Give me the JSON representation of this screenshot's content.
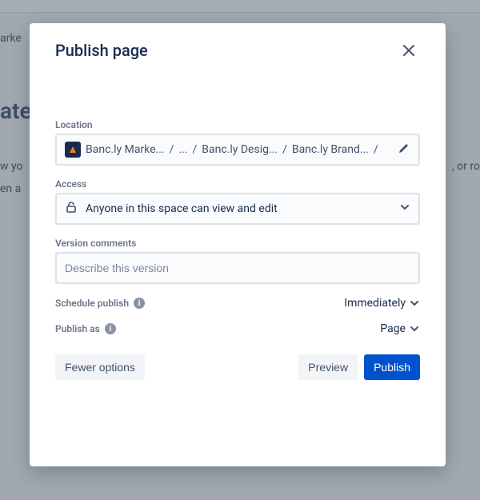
{
  "modal": {
    "title": "Publish page",
    "location": {
      "label": "Location",
      "segments": [
        "Banc.ly Marke...",
        "...",
        "Banc.ly Desig...",
        "Banc.ly Brand..."
      ],
      "sep": "/"
    },
    "access": {
      "label": "Access",
      "value": "Anyone in this space can view and edit"
    },
    "version": {
      "label": "Version comments",
      "placeholder": "Describe this version"
    },
    "schedule": {
      "label": "Schedule publish",
      "value": "Immediately"
    },
    "publishAs": {
      "label": "Publish as",
      "value": "Page"
    },
    "buttons": {
      "fewer": "Fewer options",
      "preview": "Preview",
      "publish": "Publish"
    }
  },
  "bg": {
    "b1": "arke",
    "b2": "ate",
    "b3": "w yo",
    "b4": ", or ro",
    "b5": "en a"
  }
}
